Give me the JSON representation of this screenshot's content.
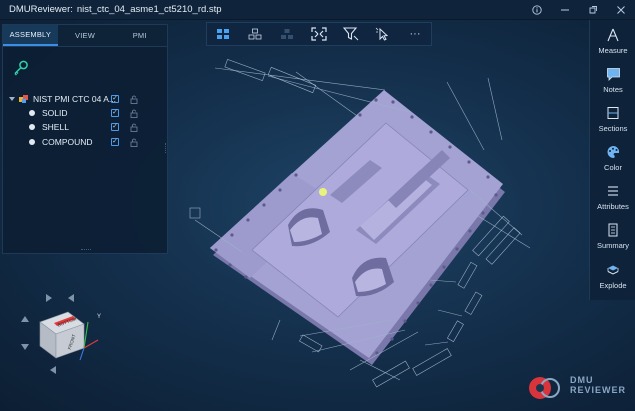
{
  "window": {
    "app_name": "DMUReviewer:",
    "file_name": "nist_ctc_04_asme1_ct5210_rd.stp",
    "controls": [
      "info-icon",
      "minimize-icon",
      "restore-icon",
      "close-icon"
    ]
  },
  "toolbar": {
    "buttons": [
      "display-mode-icon",
      "layout-icon",
      "explode-view-icon",
      "fit-all-icon",
      "filter-icon",
      "select-pointer-icon",
      "more-icon"
    ],
    "more_label": "···"
  },
  "panel": {
    "tabs": [
      {
        "label": "ASSEMBLY",
        "active": true
      },
      {
        "label": "VIEW",
        "active": false
      },
      {
        "label": "PMI",
        "active": false
      }
    ],
    "tree": {
      "root": {
        "label": "NIST PMI CTC 04 A...",
        "checked": true
      },
      "children": [
        {
          "label": "SOLID",
          "checked": true
        },
        {
          "label": "SHELL",
          "checked": true
        },
        {
          "label": "COMPOUND",
          "checked": true
        }
      ]
    },
    "check_mark": "✓"
  },
  "rightbar": {
    "items": [
      {
        "label": "Measure",
        "icon": "measure-icon"
      },
      {
        "label": "Notes",
        "icon": "notes-icon"
      },
      {
        "label": "Sections",
        "icon": "sections-icon"
      },
      {
        "label": "Color",
        "icon": "palette-icon"
      },
      {
        "label": "Attributes",
        "icon": "attributes-icon"
      },
      {
        "label": "Summary",
        "icon": "summary-icon"
      },
      {
        "label": "Explode",
        "icon": "explode-icon"
      }
    ]
  },
  "view_cube": {
    "face_top": "BOTTOM",
    "face_front": "FRONT",
    "axis_y": "Y"
  },
  "logo": {
    "line1": "DMU",
    "line2": "REVIEWER"
  },
  "colors": {
    "background": "#14304d",
    "panel": "#0c1e34",
    "accent": "#3a8ee6",
    "part": "#9a97c9",
    "logo_red": "#d8343c"
  }
}
